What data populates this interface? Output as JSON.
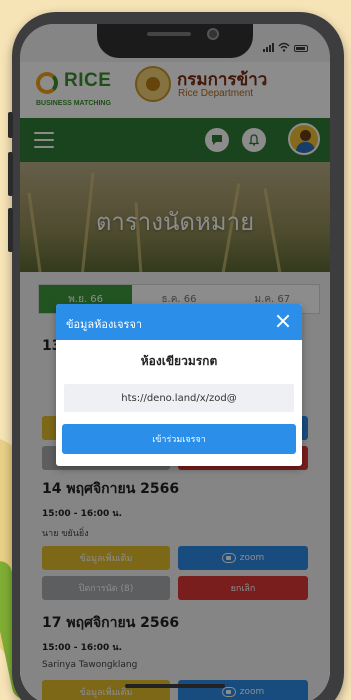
{
  "brand": {
    "logo_main": "RICE",
    "logo_sub": "BUSINESS MATCHING",
    "dept_th": "กรมการข้าว",
    "dept_en": "Rice Department"
  },
  "hero": {
    "title": "ตารางนัดหมาย"
  },
  "tabs": [
    {
      "label": "พ.ย. 66",
      "active": true
    },
    {
      "label": "ธ.ค. 66",
      "active": false
    },
    {
      "label": "ม.ค. 67",
      "active": false
    }
  ],
  "schedule": {
    "day2": {
      "title": "14 พฤศจิกายน 2566",
      "time": "15:00 - 16:00 น.",
      "person": "นาย ขยันยิ่ง",
      "info_label": "ข้อมูลเพิ่มเติม",
      "zoom_label": "zoom",
      "status_label": "ปิดการนัด (8)",
      "cancel_label": "ยกเลิก"
    },
    "day3": {
      "title": "17 พฤศจิกายน 2566",
      "time": "15:00 - 16:00 น.",
      "person": "Sarinya Tawongklang",
      "info_label": "ข้อมูลเพิ่มเติม",
      "zoom_label": "zoom"
    },
    "day1": {
      "title_prefix": "13"
    }
  },
  "modal": {
    "title": "ข้อมูลห้องเจรจา",
    "room_name": "ห้องเขียวมรกต",
    "link": "hts://deno.land/x/zod@",
    "join_label": "เข้าร่วมเจรจา"
  },
  "colors": {
    "primary_green": "#2f7d35",
    "tab_active": "#3e9a3c",
    "modal_blue": "#2b8ee8",
    "info_yellow": "#e2bd2a",
    "zoom_blue": "#2f8be6",
    "cancel_red": "#df3535"
  }
}
